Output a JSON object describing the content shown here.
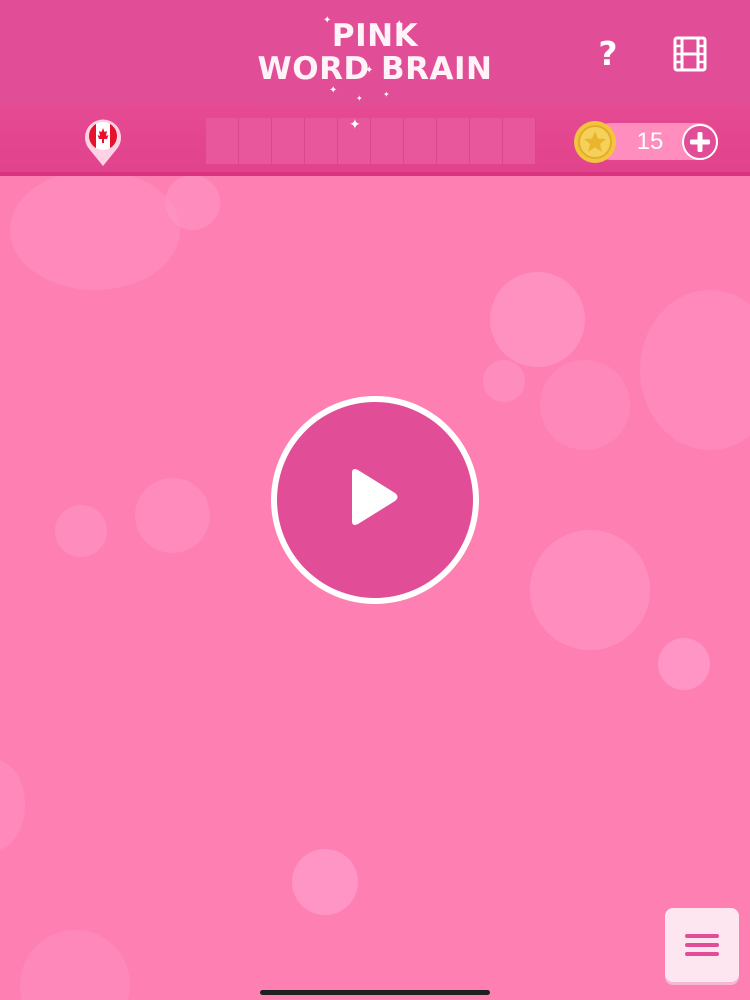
{
  "header": {
    "title_line1": "PINK",
    "title_line2": "WORD BRAIN",
    "help_label": "?",
    "video_icon": "film-icon"
  },
  "subbar": {
    "flag_icon": "canada-flag-pin-icon",
    "word_slot_count": 10,
    "coins": "15",
    "coin_icon": "star-coin-icon",
    "add_icon": "plus-icon"
  },
  "main": {
    "play_icon": "play-icon"
  },
  "footer": {
    "menu_icon": "hamburger-menu-icon"
  },
  "colors": {
    "background": "#fe80b3",
    "header": "#e14d96",
    "accent": "#e14d96",
    "coin": "#f3c53f"
  }
}
